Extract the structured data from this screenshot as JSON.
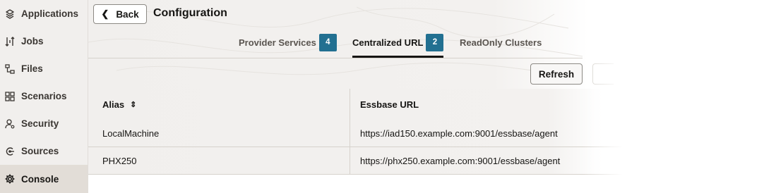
{
  "sidebar": {
    "items": [
      {
        "label": "Applications",
        "icon": "applications-icon",
        "active": false
      },
      {
        "label": "Jobs",
        "icon": "jobs-icon",
        "active": false
      },
      {
        "label": "Files",
        "icon": "files-icon",
        "active": false
      },
      {
        "label": "Scenarios",
        "icon": "scenarios-icon",
        "active": false
      },
      {
        "label": "Security",
        "icon": "security-icon",
        "active": false
      },
      {
        "label": "Sources",
        "icon": "sources-icon",
        "active": false
      },
      {
        "label": "Console",
        "icon": "console-gear-icon",
        "active": true
      }
    ]
  },
  "header": {
    "back_label": "Back",
    "title": "Configuration"
  },
  "tabs": [
    {
      "label": "Provider Services",
      "badge": "4",
      "active": false
    },
    {
      "label": "Centralized URL",
      "badge": "2",
      "active": true
    },
    {
      "label": "ReadOnly Clusters",
      "badge": "",
      "active": false
    }
  ],
  "toolbar": {
    "refresh_label": "Refresh"
  },
  "table": {
    "columns": [
      "Alias",
      "Essbase URL"
    ],
    "rows": [
      {
        "alias": "LocalMachine",
        "url": "https://iad150.example.com:9001/essbase/agent"
      },
      {
        "alias": "PHX250",
        "url": "https://phx250.example.com:9001/essbase/agent"
      }
    ]
  },
  "colors": {
    "accent": "#227091",
    "sidebar_bg": "#f1efed",
    "active_bg": "#e2ddd7"
  }
}
